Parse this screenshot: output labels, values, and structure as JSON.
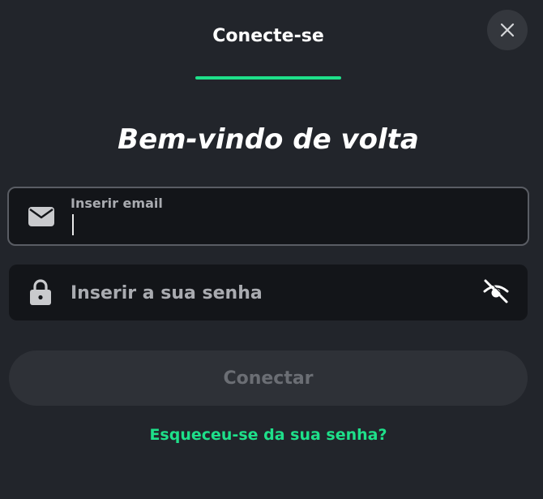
{
  "tabs": [
    {
      "label": "Conecte-se",
      "active": true
    }
  ],
  "heading": "Bem-vindo de volta",
  "email": {
    "label": "Inserir email",
    "value": ""
  },
  "password": {
    "placeholder": "Inserir a sua senha",
    "value": ""
  },
  "submit_label": "Conectar",
  "forgot_link": "Esqueceu-se da sua senha?",
  "icons": {
    "close": "close-icon",
    "email": "envelope-icon",
    "password": "lock-icon",
    "visibility": "eye-slash-icon"
  },
  "colors": {
    "accent": "#1ee08a",
    "background": "#22252b",
    "field_background": "#131519",
    "button_disabled": "#2e3137"
  }
}
